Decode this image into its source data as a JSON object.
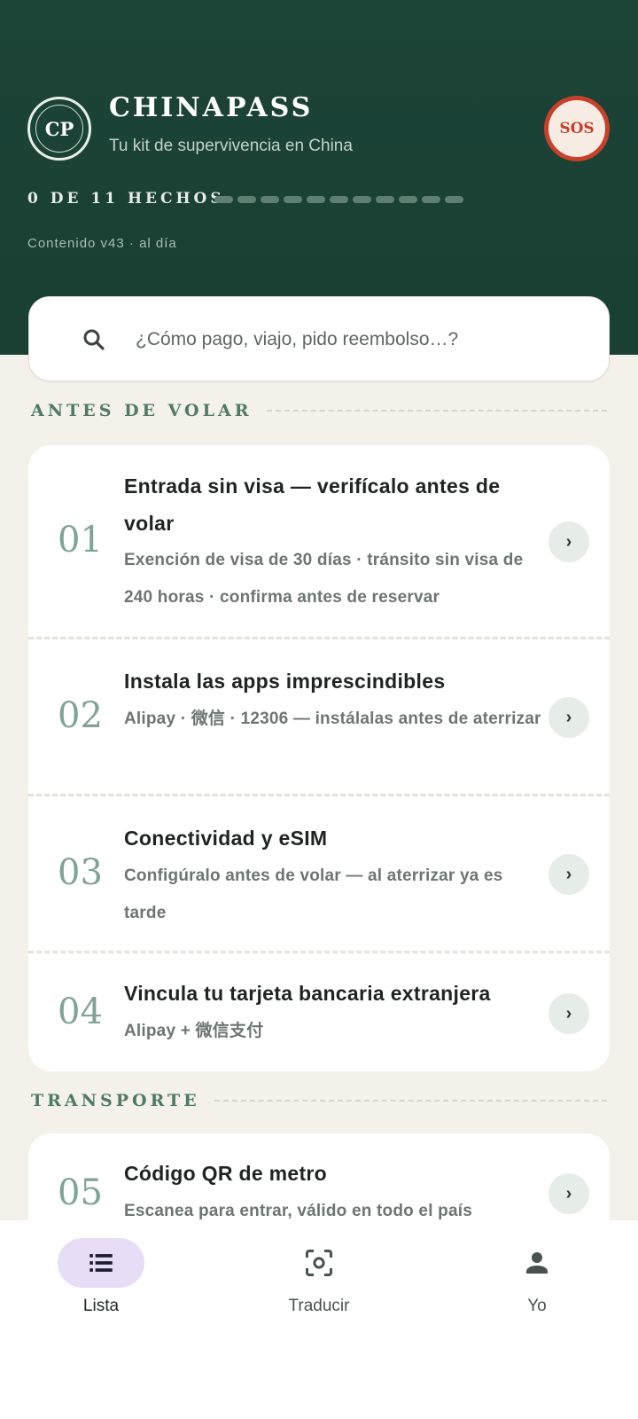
{
  "header": {
    "logo_text": "CP",
    "title": "CHINAPASS",
    "subtitle": "Tu kit de supervivencia en China",
    "sos_label": "SOS",
    "progress_label": "0 DE 11 HECHOS",
    "progress": {
      "done": 0,
      "total": 11
    },
    "content_version": "Contenido v43 · al día"
  },
  "search": {
    "icon": "search-icon",
    "placeholder": "¿Cómo pago, viajo, pido reembolso…?",
    "value": ""
  },
  "sections": [
    {
      "label": "ANTES DE VOLAR",
      "items": [
        {
          "number": "01",
          "title": "Entrada sin visa — verifícalo antes de volar",
          "description": "Exención de visa de 30 días · tránsito sin visa de 240 horas · confirma antes de reservar",
          "chevron": "›"
        },
        {
          "number": "02",
          "title": "Instala las apps imprescindibles",
          "description": "Alipay · 微信 · 12306 — instálalas antes de aterrizar",
          "chevron": "›"
        },
        {
          "number": "03",
          "title": "Conectividad y eSIM",
          "description": "Configúralo antes de volar — al aterrizar ya es tarde",
          "chevron": "›"
        },
        {
          "number": "04",
          "title": "Vincula tu tarjeta bancaria extranjera",
          "description": "Alipay + 微信支付",
          "chevron": "›"
        }
      ]
    },
    {
      "label": "TRANSPORTE",
      "items": [
        {
          "number": "05",
          "title": "Código QR de metro",
          "description": "Escanea para entrar, válido en todo el país",
          "chevron": "›"
        }
      ]
    }
  ],
  "bottom_nav": [
    {
      "label": "Lista",
      "icon": "list-icon",
      "active": true
    },
    {
      "label": "Traducir",
      "icon": "scan-translate-icon",
      "active": false
    },
    {
      "label": "Yo",
      "icon": "person-icon",
      "active": false
    }
  ],
  "colors": {
    "header_bg": "#1c4437",
    "page_bg": "#f4f1ea",
    "accent_green": "#4e7a66",
    "sos_red": "#c8402a",
    "active_nav_pill": "#e8ddf6"
  }
}
